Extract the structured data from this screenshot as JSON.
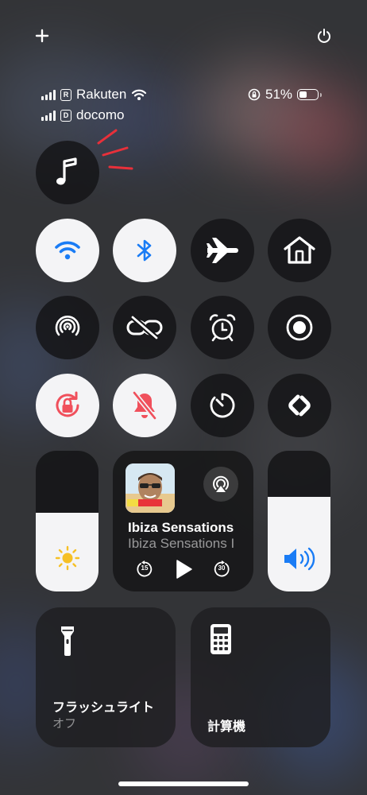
{
  "top": {
    "add_icon": "plus-icon",
    "power_icon": "power-icon"
  },
  "status": {
    "carrier1": "Rakuten",
    "carrier1_badge": "R",
    "carrier2": "docomo",
    "carrier2_badge": "D",
    "battery_percent": "51%",
    "battery_level": 0.51
  },
  "tiles": {
    "music": "music-note-icon",
    "wifi": "wifi-icon",
    "bluetooth": "bluetooth-icon",
    "airplane": "airplane-icon",
    "home": "home-icon",
    "airdrop": "airdrop-icon",
    "link": "link-slash-icon",
    "alarm": "alarm-clock-icon",
    "record": "screen-record-icon",
    "rotation_lock": "rotation-lock-icon",
    "silent": "bell-slash-icon",
    "timer": "timer-icon",
    "shazam": "shazam-icon"
  },
  "brightness_level": 0.56,
  "volume_level": 0.67,
  "now_playing": {
    "title": "Ibiza Sensations",
    "subtitle": "Ibiza Sensations I",
    "skip_back": "15",
    "skip_forward": "30"
  },
  "flashlight": {
    "label": "フラッシュライト",
    "state": "オフ"
  },
  "calculator": {
    "label": "計算機"
  },
  "colors": {
    "accent_blue": "#1a7cf5",
    "alert_red": "#f0505c",
    "annotation_red": "#e8303a",
    "tile_light": "#f4f4f6",
    "tile_dark": "#161618"
  }
}
